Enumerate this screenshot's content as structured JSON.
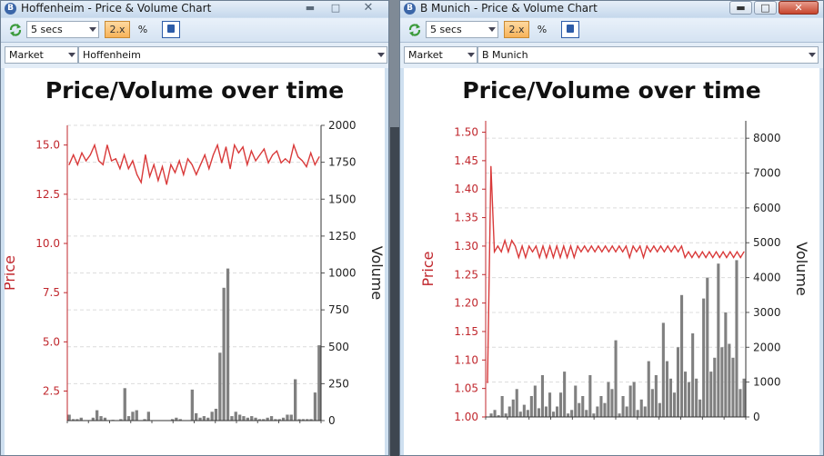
{
  "windows": [
    {
      "title": "Hoffenheim - Price & Volume Chart",
      "refresh_interval": "5 secs",
      "speed_label": "2.x",
      "percent_label": "%",
      "filter_type": "Market",
      "filter_value": "Hoffenheim",
      "chart_title": "Price/Volume over time",
      "left_axis_label": "Price",
      "right_axis_label": "Volume"
    },
    {
      "title": "B Munich - Price & Volume Chart",
      "refresh_interval": "5 secs",
      "speed_label": "2.x",
      "percent_label": "%",
      "filter_type": "Market",
      "filter_value": "B Munich",
      "chart_title": "Price/Volume over time",
      "left_axis_label": "Price",
      "right_axis_label": "Volume"
    }
  ],
  "colors": {
    "price_line": "#d93a3a",
    "volume_bars": "#808080",
    "price_axis": "#c0272d",
    "window_frame": "#cfe0f0"
  },
  "icons": [
    "refresh-icon",
    "pin-icon",
    "minimize-icon",
    "maximize-icon",
    "close-icon",
    "app-logo-icon",
    "dropdown-arrow-icon"
  ],
  "chart_data": [
    {
      "type": "line",
      "title": "Price/Volume over time",
      "ylabel": "Price",
      "y2label": "Volume",
      "ylim": [
        1.0,
        16.0
      ],
      "y2lim": [
        0,
        2000
      ],
      "yticks": [
        "2.5",
        "5.0",
        "7.5",
        "10.0",
        "12.5",
        "15.0"
      ],
      "y2ticks": [
        "0",
        "250",
        "500",
        "750",
        "1000",
        "1250",
        "1500",
        "1750",
        "2000"
      ],
      "grid": true,
      "price": [
        14.0,
        14.5,
        14.0,
        14.6,
        14.2,
        14.5,
        15.0,
        14.2,
        14.0,
        15.0,
        14.2,
        14.3,
        13.8,
        14.5,
        13.8,
        14.2,
        13.5,
        13.1,
        14.5,
        13.4,
        14.0,
        13.2,
        13.9,
        13.0,
        14.0,
        13.6,
        14.2,
        13.5,
        14.3,
        14.0,
        13.5,
        14.0,
        14.5,
        13.8,
        14.5,
        15.0,
        14.1,
        14.9,
        13.8,
        15.0,
        14.6,
        14.9,
        14.0,
        14.7,
        14.2,
        14.5,
        14.8,
        14.1,
        14.5,
        14.7,
        14.1,
        14.3,
        14.1,
        15.0,
        14.4,
        14.2,
        13.9,
        14.6,
        14.0,
        14.4
      ],
      "volume": [
        40,
        10,
        10,
        20,
        0,
        0,
        20,
        70,
        30,
        20,
        0,
        5,
        0,
        10,
        220,
        30,
        60,
        70,
        0,
        10,
        60,
        0,
        0,
        0,
        0,
        0,
        10,
        20,
        10,
        0,
        0,
        210,
        50,
        20,
        30,
        20,
        60,
        80,
        460,
        900,
        1030,
        30,
        60,
        40,
        30,
        20,
        30,
        20,
        10,
        10,
        20,
        30,
        10,
        10,
        20,
        40,
        40,
        280,
        10,
        10,
        10,
        10,
        190,
        510
      ]
    },
    {
      "type": "line",
      "title": "Price/Volume over time",
      "ylabel": "Price",
      "y2label": "Volume",
      "ylim": [
        1.0,
        1.52
      ],
      "y2lim": [
        0,
        8500
      ],
      "yticks": [
        "1.00",
        "1.05",
        "1.10",
        "1.15",
        "1.20",
        "1.25",
        "1.30",
        "1.35",
        "1.40",
        "1.45",
        "1.50"
      ],
      "y2ticks": [
        "0",
        "1000",
        "2000",
        "3000",
        "4000",
        "5000",
        "6000",
        "7000",
        "8000"
      ],
      "grid": true,
      "price": [
        1.06,
        1.44,
        1.29,
        1.3,
        1.29,
        1.31,
        1.29,
        1.31,
        1.3,
        1.28,
        1.3,
        1.28,
        1.3,
        1.29,
        1.3,
        1.28,
        1.3,
        1.28,
        1.3,
        1.28,
        1.3,
        1.28,
        1.3,
        1.28,
        1.3,
        1.28,
        1.3,
        1.29,
        1.3,
        1.29,
        1.3,
        1.29,
        1.3,
        1.29,
        1.3,
        1.29,
        1.3,
        1.29,
        1.3,
        1.29,
        1.3,
        1.28,
        1.3,
        1.29,
        1.3,
        1.28,
        1.3,
        1.29,
        1.3,
        1.29,
        1.3,
        1.29,
        1.3,
        1.29,
        1.3,
        1.29,
        1.3,
        1.28,
        1.29,
        1.28,
        1.29,
        1.28,
        1.29,
        1.28,
        1.29,
        1.28,
        1.29,
        1.28,
        1.29,
        1.28,
        1.29,
        1.28,
        1.29,
        1.28,
        1.29
      ],
      "volume": [
        0,
        100,
        200,
        50,
        600,
        100,
        300,
        500,
        800,
        150,
        350,
        200,
        600,
        900,
        250,
        1200,
        300,
        700,
        150,
        300,
        700,
        1300,
        100,
        200,
        900,
        400,
        600,
        200,
        1200,
        100,
        300,
        600,
        400,
        1000,
        800,
        2200,
        100,
        600,
        300,
        900,
        1000,
        200,
        500,
        300,
        1600,
        800,
        1200,
        400,
        2700,
        1600,
        1100,
        700,
        2000,
        3500,
        1300,
        1000,
        2400,
        1100,
        500,
        3400,
        4000,
        1300,
        1700,
        4400,
        2000,
        3000,
        2100,
        1700,
        4500,
        800,
        1100
      ]
    }
  ]
}
